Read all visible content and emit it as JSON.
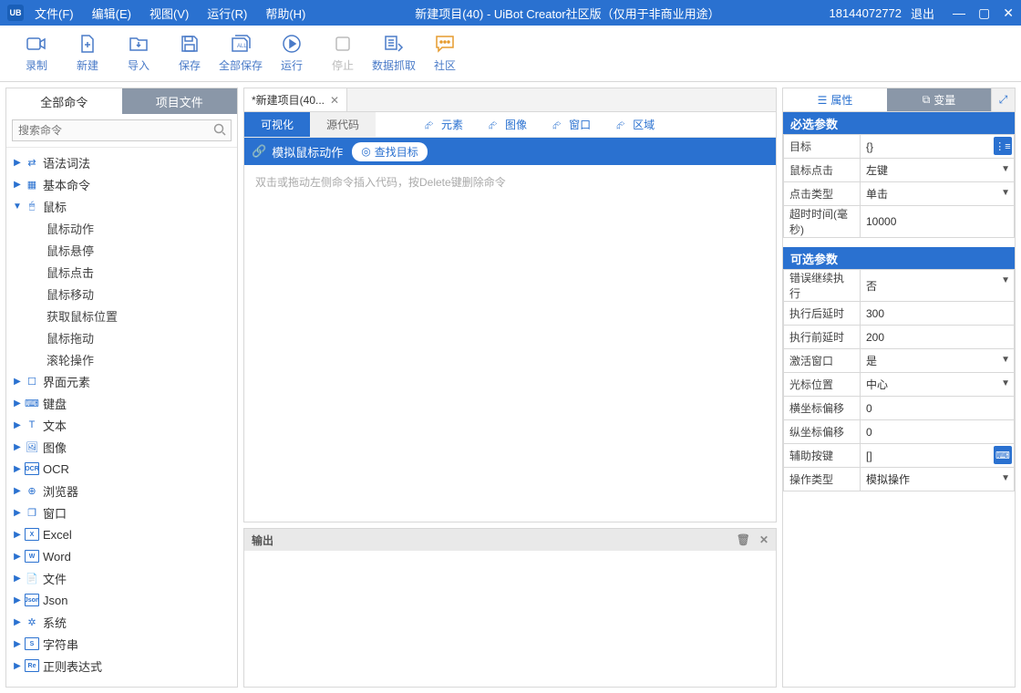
{
  "titlebar": {
    "logo": "UB",
    "menus": [
      "文件(F)",
      "编辑(E)",
      "视图(V)",
      "运行(R)",
      "帮助(H)"
    ],
    "title": "新建项目(40) - UiBot Creator社区版（仅用于非商业用途）",
    "phone": "18144072772",
    "logout": "退出"
  },
  "toolbar": {
    "items": [
      "录制",
      "新建",
      "导入",
      "保存",
      "全部保存",
      "运行",
      "停止",
      "数据抓取",
      "社区"
    ],
    "disabled_index": 6
  },
  "left": {
    "tabs": [
      "全部命令",
      "项目文件"
    ],
    "search_placeholder": "搜索命令",
    "nodes": [
      {
        "label": "语法词法",
        "icon": "flow"
      },
      {
        "label": "基本命令",
        "icon": "grid"
      },
      {
        "label": "鼠标",
        "icon": "mouse",
        "expanded": true,
        "children": [
          "鼠标动作",
          "鼠标悬停",
          "鼠标点击",
          "鼠标移动",
          "获取鼠标位置",
          "鼠标拖动",
          "滚轮操作"
        ]
      },
      {
        "label": "界面元素",
        "icon": "ui"
      },
      {
        "label": "键盘",
        "icon": "kb"
      },
      {
        "label": "文本",
        "icon": "txt"
      },
      {
        "label": "图像",
        "icon": "img"
      },
      {
        "label": "OCR",
        "icon": "ocr"
      },
      {
        "label": "浏览器",
        "icon": "web"
      },
      {
        "label": "窗口",
        "icon": "win"
      },
      {
        "label": "Excel",
        "icon": "xls"
      },
      {
        "label": "Word",
        "icon": "doc"
      },
      {
        "label": "文件",
        "icon": "file"
      },
      {
        "label": "Json",
        "icon": "json"
      },
      {
        "label": "系统",
        "icon": "sys"
      },
      {
        "label": "字符串",
        "icon": "str"
      },
      {
        "label": "正则表达式",
        "icon": "re"
      }
    ]
  },
  "center": {
    "file_tab": "*新建项目(40...",
    "mode_tabs": [
      "可视化",
      "源代码"
    ],
    "pickers": [
      "元素",
      "图像",
      "窗口",
      "区域"
    ],
    "action_label": "模拟鼠标动作",
    "find_target": "查找目标",
    "hint": "双击或拖动左侧命令插入代码，按Delete键删除命令",
    "output_title": "输出"
  },
  "right": {
    "tabs": [
      "属性",
      "变量"
    ],
    "section_required": "必选参数",
    "section_optional": "可选参数",
    "required": [
      {
        "key": "目标",
        "val": "{}",
        "extra": "list"
      },
      {
        "key": "鼠标点击",
        "val": "左键",
        "drop": true
      },
      {
        "key": "点击类型",
        "val": "单击",
        "drop": true
      },
      {
        "key": "超时时间(毫秒)",
        "val": "10000"
      }
    ],
    "optional": [
      {
        "key": "错误继续执行",
        "val": "否",
        "drop": true
      },
      {
        "key": "执行后延时",
        "val": "300"
      },
      {
        "key": "执行前延时",
        "val": "200"
      },
      {
        "key": "激活窗口",
        "val": "是",
        "drop": true
      },
      {
        "key": "光标位置",
        "val": "中心",
        "drop": true
      },
      {
        "key": "横坐标偏移",
        "val": "0"
      },
      {
        "key": "纵坐标偏移",
        "val": "0"
      },
      {
        "key": "辅助按键",
        "val": "[]",
        "extra": "kb"
      },
      {
        "key": "操作类型",
        "val": "模拟操作",
        "drop": true
      }
    ]
  }
}
